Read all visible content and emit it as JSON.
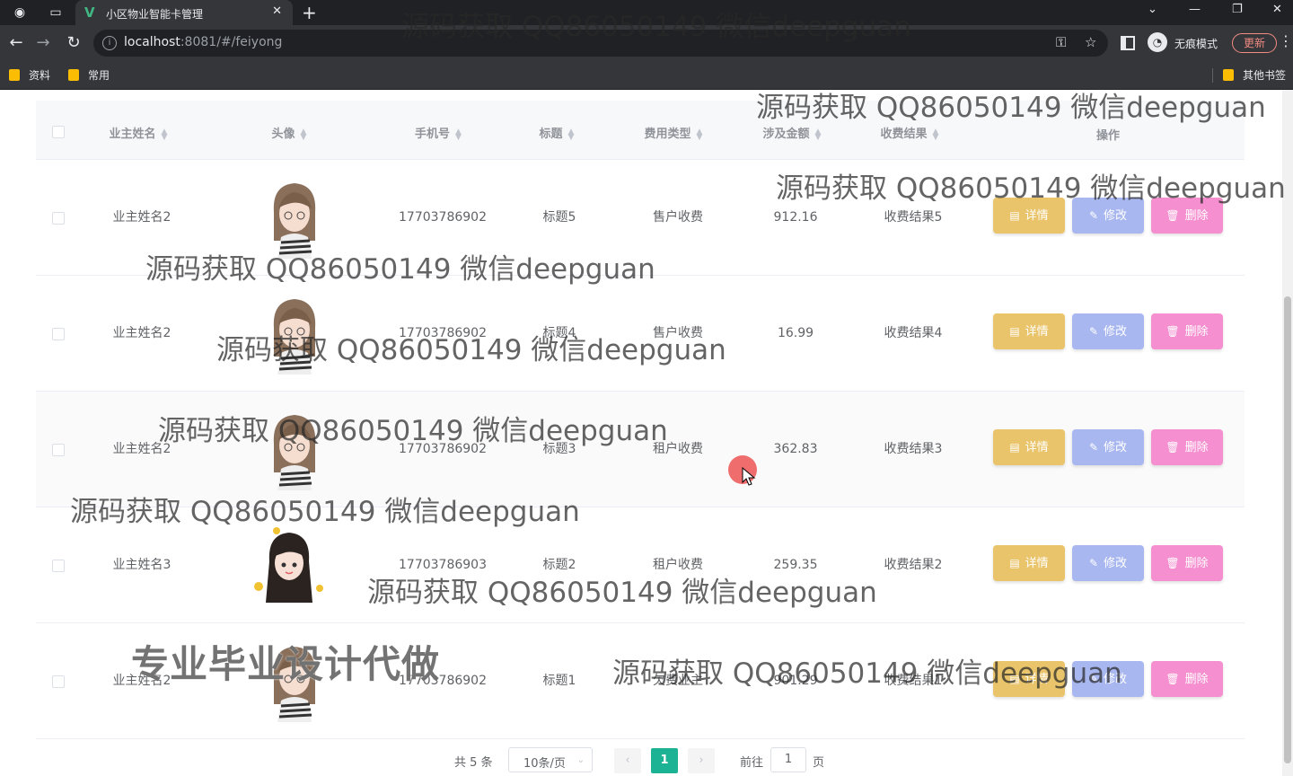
{
  "browser": {
    "tab_title": "小区物业智能卡管理",
    "tab_close": "✕",
    "new_tab": "+",
    "url_host": "localhost",
    "url_rest": ":8081/#/feiyong",
    "incognito_label": "无痕模式",
    "update_label": "更新",
    "bookmarks": [
      "资料",
      "常用"
    ],
    "other_bookmarks": "其他书签"
  },
  "table": {
    "headers": {
      "owner_name": "业主姓名",
      "avatar": "头像",
      "phone": "手机号",
      "title": "标题",
      "fee_type": "费用类型",
      "amount": "涉及金额",
      "result": "收费结果",
      "actions": "操作"
    },
    "rows": [
      {
        "owner_name": "业主姓名2",
        "phone": "17703786902",
        "title": "标题5",
        "fee_type": "售户收费",
        "amount": "912.16",
        "result": "收费结果5"
      },
      {
        "owner_name": "业主姓名2",
        "phone": "17703786902",
        "title": "标题4",
        "fee_type": "售户收费",
        "amount": "16.99",
        "result": "收费结果4"
      },
      {
        "owner_name": "业主姓名2",
        "phone": "17703786902",
        "title": "标题3",
        "fee_type": "租户收费",
        "amount": "362.83",
        "result": "收费结果3"
      },
      {
        "owner_name": "业主姓名3",
        "phone": "17703786903",
        "title": "标题2",
        "fee_type": "租户收费",
        "amount": "259.35",
        "result": "收费结果2"
      },
      {
        "owner_name": "业主姓名2",
        "phone": "17703786902",
        "title": "标题1",
        "fee_type": "欠费业主",
        "amount": "901.29",
        "result": "收费结果1"
      }
    ],
    "buttons": {
      "detail": "详情",
      "edit": "修改",
      "delete": "删除"
    }
  },
  "pagination": {
    "total": "共 5 条",
    "page_size": "10条/页",
    "current_page": "1",
    "goto_label": "前往",
    "goto_value": "1",
    "unit": "页"
  },
  "watermarks": {
    "text": "源码获取 QQ86050149 微信deepguan",
    "big": "专业毕业设计代做"
  },
  "colors": {
    "detail": "#e9c46a",
    "edit": "#a9b7f0",
    "delete": "#f58fcf",
    "active_page": "#1bb394"
  }
}
